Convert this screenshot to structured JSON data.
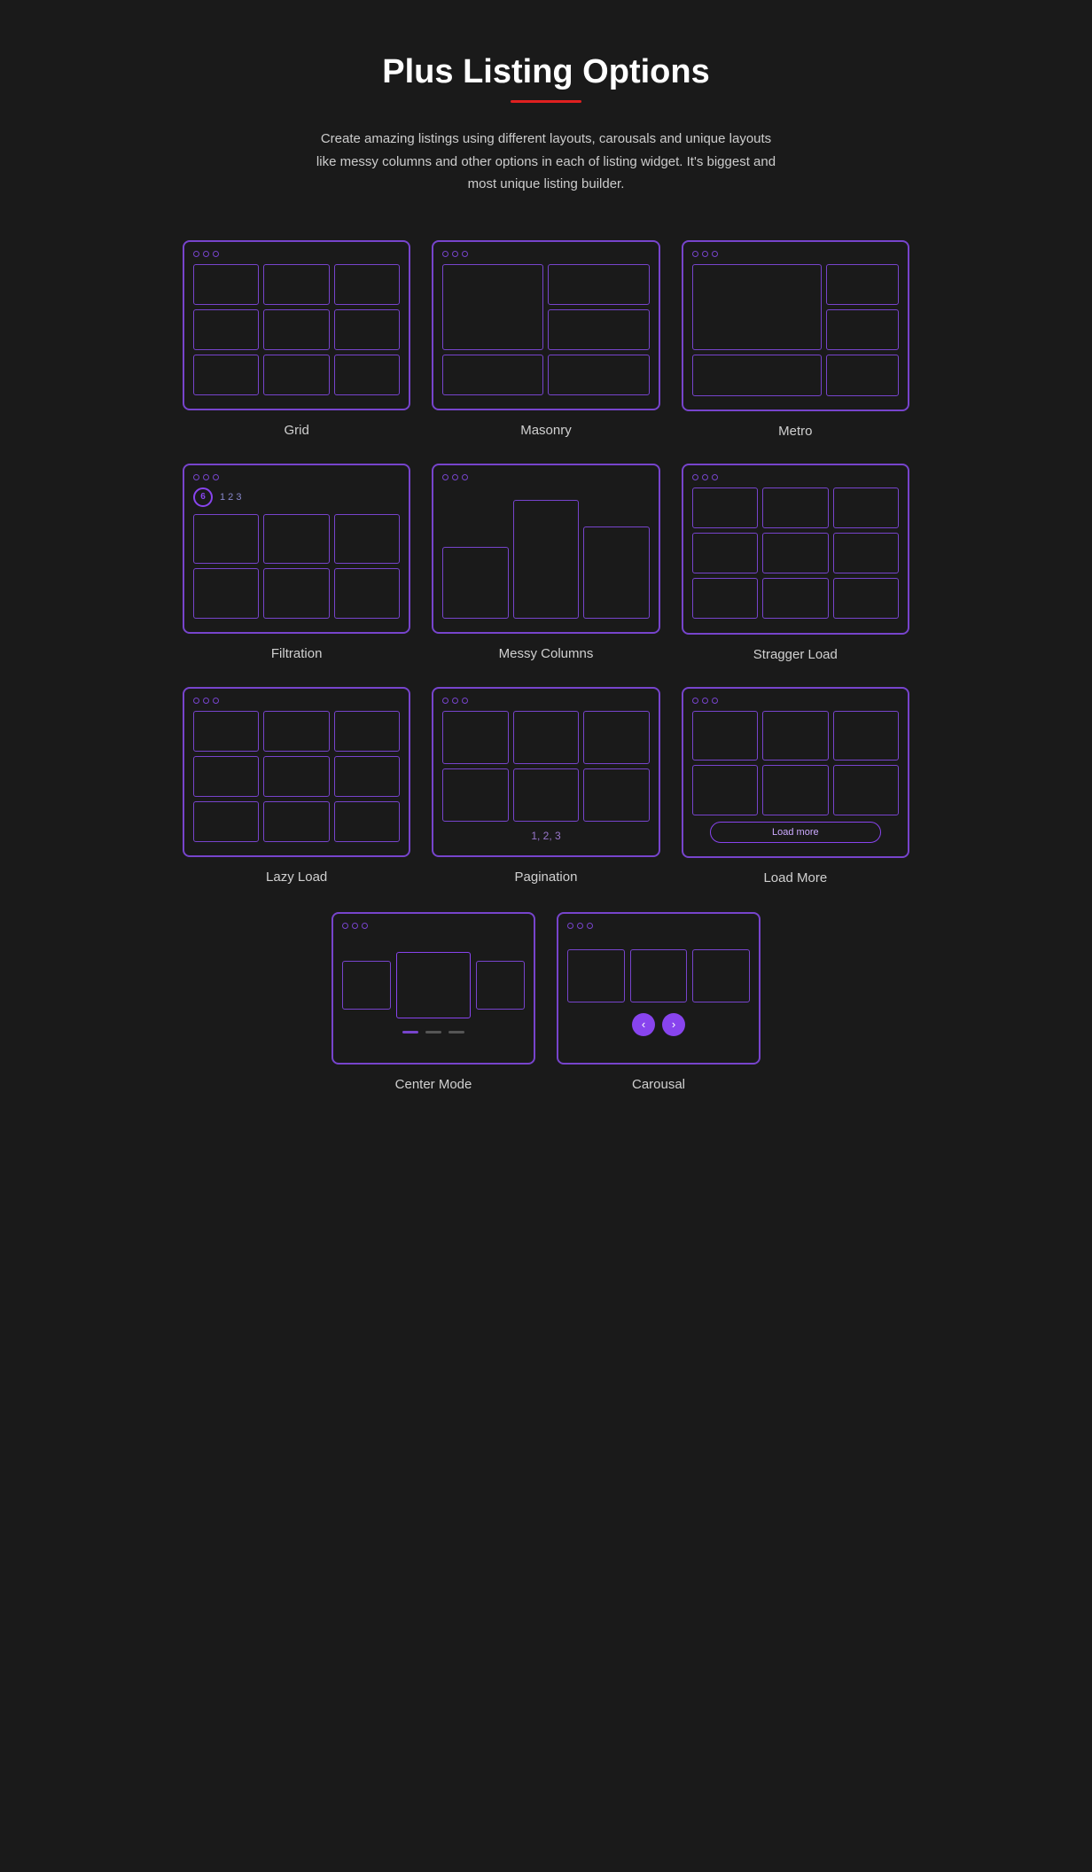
{
  "page": {
    "title": "Plus Listing Options",
    "description": "Create amazing listings using different layouts, carousals and unique layouts like messy columns and other options in each of listing widget. It's biggest and most unique listing builder.",
    "accent_color": "#e02020",
    "border_color": "#7744cc"
  },
  "cards": [
    {
      "id": "grid",
      "label": "Grid",
      "type": "grid"
    },
    {
      "id": "masonry",
      "label": "Masonry",
      "type": "masonry"
    },
    {
      "id": "metro",
      "label": "Metro",
      "type": "metro"
    },
    {
      "id": "filtration",
      "label": "Filtration",
      "type": "filtration"
    },
    {
      "id": "messy",
      "label": "Messy Columns",
      "type": "messy"
    },
    {
      "id": "stragger",
      "label": "Stragger Load",
      "type": "stragger"
    },
    {
      "id": "lazyload",
      "label": "Lazy Load",
      "type": "lazyload"
    },
    {
      "id": "pagination",
      "label": "Pagination",
      "type": "pagination"
    },
    {
      "id": "loadmore",
      "label": "Load More",
      "type": "loadmore"
    }
  ],
  "bottom_cards": [
    {
      "id": "centermode",
      "label": "Center Mode",
      "type": "centermode"
    },
    {
      "id": "carousal",
      "label": "Carousal",
      "type": "carousal"
    }
  ],
  "filtration": {
    "circle_num": "6",
    "nums": "1  2  3"
  },
  "pagination": {
    "nums": "1, 2, 3"
  },
  "loadmore": {
    "btn_label": "Load more"
  }
}
